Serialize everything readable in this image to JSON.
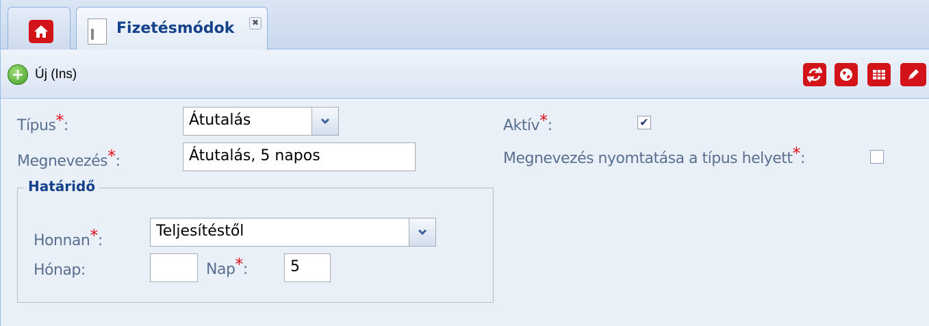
{
  "tabs": {
    "active_label": "Fizetésmódok",
    "close_glyph": "✖"
  },
  "toolbar": {
    "new_label": "Új (Ins)",
    "icons": [
      "refresh-icon",
      "globe-icon",
      "grid-icon",
      "edit-icon"
    ]
  },
  "form": {
    "type_label": "Típus",
    "type_value": "Átutalás",
    "name_label": "Megnevezés",
    "name_value": "Átutalás,  5 napos",
    "active_label": "Aktív",
    "active_checked": true,
    "print_name_label": "Megnevezés nyomtatása a típus helyett",
    "print_name_checked": false,
    "required_marker": "*",
    "colon": ":"
  },
  "deadline": {
    "legend": "Határidő",
    "from_label": "Honnan",
    "from_value": "Teljesítéstől",
    "month_label": "Hónap:",
    "month_value": "",
    "day_label": "Nap",
    "day_value": "5"
  },
  "colors": {
    "accent_red": "#d2141a",
    "label_blue": "#5a6f8f",
    "title_blue": "#15428b"
  }
}
